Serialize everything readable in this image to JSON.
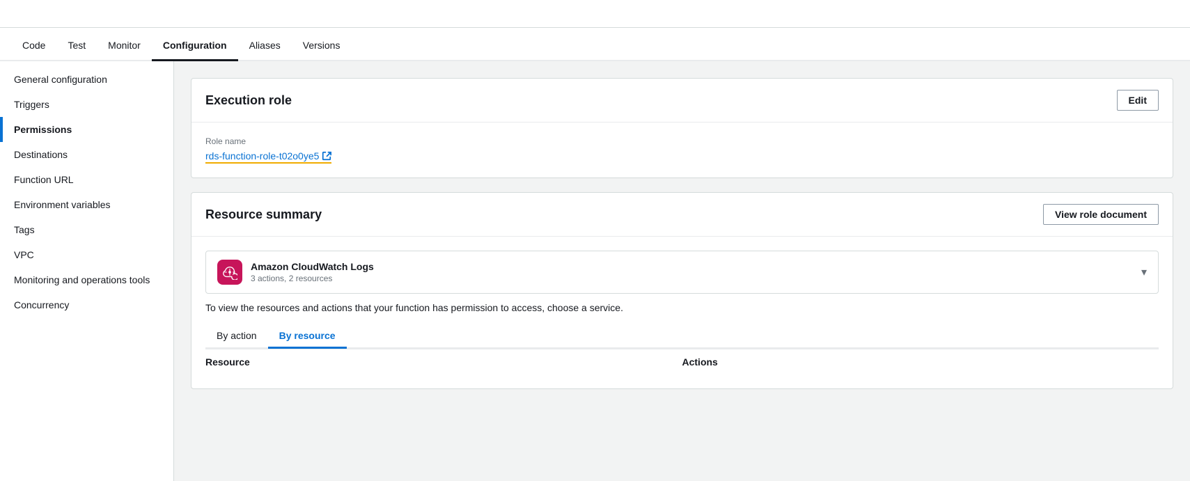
{
  "topBar": {},
  "tabs": [
    {
      "label": "Code",
      "active": false
    },
    {
      "label": "Test",
      "active": false
    },
    {
      "label": "Monitor",
      "active": false
    },
    {
      "label": "Configuration",
      "active": true
    },
    {
      "label": "Aliases",
      "active": false
    },
    {
      "label": "Versions",
      "active": false
    }
  ],
  "sidebar": {
    "items": [
      {
        "label": "General configuration",
        "active": false
      },
      {
        "label": "Triggers",
        "active": false
      },
      {
        "label": "Permissions",
        "active": true
      },
      {
        "label": "Destinations",
        "active": false
      },
      {
        "label": "Function URL",
        "active": false
      },
      {
        "label": "Environment variables",
        "active": false
      },
      {
        "label": "Tags",
        "active": false
      },
      {
        "label": "VPC",
        "active": false
      },
      {
        "label": "Monitoring and operations tools",
        "active": false
      },
      {
        "label": "Concurrency",
        "active": false
      }
    ]
  },
  "executionRole": {
    "sectionTitle": "Execution role",
    "editButtonLabel": "Edit",
    "roleNameLabel": "Role name",
    "roleNameValue": "rds-function-role-t02o0ye5"
  },
  "resourceSummary": {
    "sectionTitle": "Resource summary",
    "viewRoleDocumentLabel": "View role document",
    "service": {
      "name": "Amazon CloudWatch Logs",
      "meta": "3 actions, 2 resources"
    },
    "infoText": "To view the resources and actions that your function has permission to access, choose a service.",
    "innerTabs": [
      {
        "label": "By action",
        "active": false
      },
      {
        "label": "By resource",
        "active": true
      }
    ],
    "tableHeaders": [
      {
        "label": "Resource"
      },
      {
        "label": "Actions"
      }
    ]
  }
}
